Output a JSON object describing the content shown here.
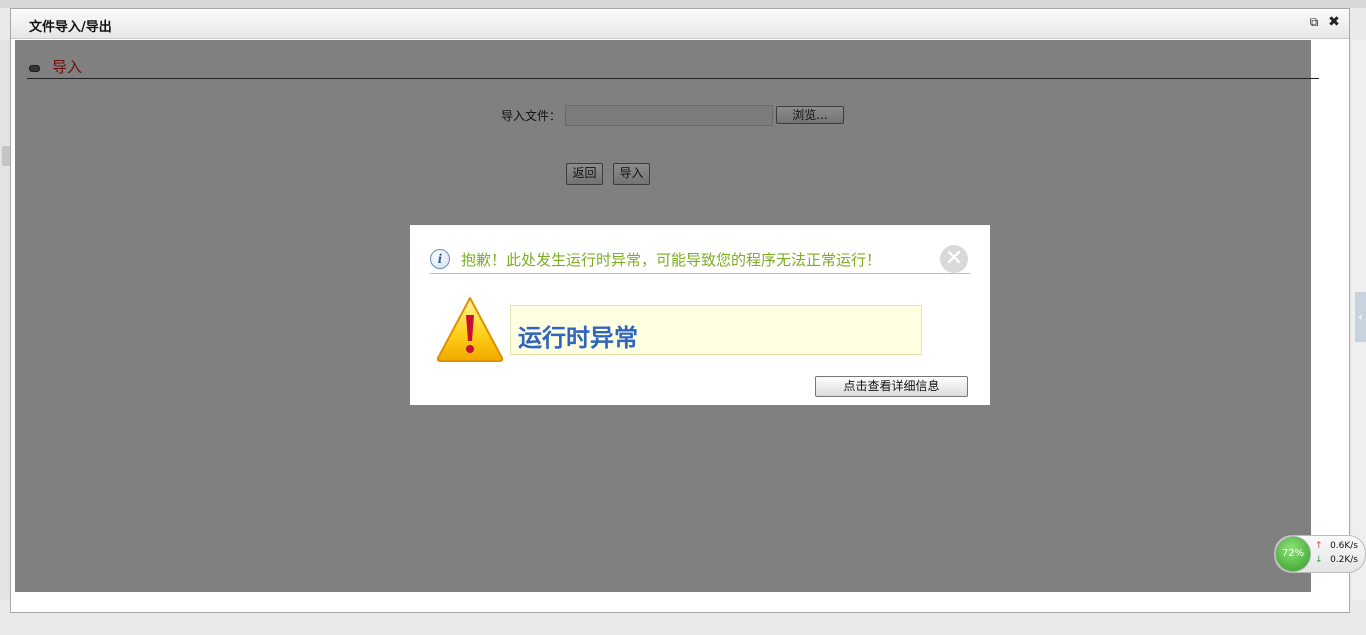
{
  "window": {
    "title": "文件导入/导出",
    "restore_icon": "restore-window-icon",
    "close_icon": "close-icon",
    "restore_glyph": "⧉",
    "close_glyph": "✖"
  },
  "import_form": {
    "section_title": "导入",
    "file_label": "导入文件：",
    "file_value": "",
    "browse_label": "浏览...",
    "back_label": "返回",
    "import_label": "导入"
  },
  "error_dialog": {
    "message": "抱歉！此处发生运行时异常，可能导致您的程序无法正常运行！",
    "title": "运行时异常",
    "detail_button": "点击查看详细信息",
    "info_glyph": "i",
    "close_glyph": "✕",
    "message_color": "#7cae22",
    "title_color": "#2f65c0"
  },
  "net_speed": {
    "percent": "72%",
    "up": "0.6K/s",
    "down": "0.2K/s",
    "up_glyph": "↑",
    "down_glyph": "↓"
  },
  "side_tab": {
    "glyph": "‹"
  }
}
